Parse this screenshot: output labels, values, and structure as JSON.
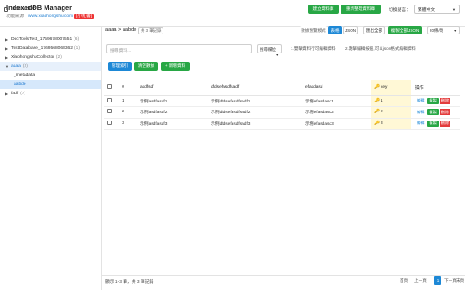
{
  "app": {
    "title": "IndexedDB Manager",
    "subtitle_prefix": "功能來源：",
    "subtitle_link": "www.xiaohongshu.com",
    "subtitle_badge": "[小紅書]"
  },
  "header": {
    "create_db": "建立資料庫",
    "reload_db": "重新整理資料庫",
    "lang_label": "切換語言：",
    "lang_value": "繁體中文"
  },
  "sidebar": {
    "title": "IndexedDB",
    "items": [
      {
        "label": "DocToolsTest_1759678007551",
        "count": "(6)"
      },
      {
        "label": "TestDatabase_1769568068362",
        "count": "(1)"
      },
      {
        "label": "XiaohongshuCollector",
        "count": "(2)"
      },
      {
        "label": "aaaa",
        "count": "(2)"
      },
      {
        "label": "_metadata"
      },
      {
        "label": "aabde"
      },
      {
        "label": "fadf",
        "count": "(7)"
      }
    ]
  },
  "main": {
    "breadcrumb": "aaaa > aabde",
    "records_badge": "共 3 筆記錄",
    "view_modes": {
      "label": "數據預覽模式",
      "table": "表格",
      "json": "JSON"
    },
    "export_all": "匯出全部",
    "copy_json": "複製全部JSON",
    "page_size": "20條/頁",
    "search_placeholder": "搜尋資料...",
    "field_select": "搜尋欄位",
    "hint1": "1.雙擊資料行可編輯資料",
    "hint2": "2.點擊編輯按鈕,可以json格式編輯資料",
    "manage_index": "管理索引",
    "clear_data": "清空數據",
    "add_data": "+ 新增資料",
    "columns": {
      "num": "#",
      "c1": "asdfsdf",
      "c2": "dfdsefasdfsadf",
      "c3": "efasdasd",
      "key": "key",
      "ops": "操作"
    },
    "rows": [
      {
        "num": "1",
        "c1": "示例asdfasdf1",
        "c2": "示例dfdsefasdfsadf1",
        "c3": "示例efasdasd1",
        "key": "1"
      },
      {
        "num": "2",
        "c1": "示例asdfasdf2",
        "c2": "示例dfdsefasdfsadf2",
        "c3": "示例efasdasd2",
        "key": "2"
      },
      {
        "num": "3",
        "c1": "示例asdfasdf3",
        "c2": "示例dfdsefasdfsadf3",
        "c3": "示例efasdasd3",
        "key": "3"
      }
    ],
    "row_actions": {
      "edit": "編輯",
      "copy": "複製",
      "delete": "刪除"
    },
    "footer": "顯示 1-3 筆，共 3 筆記錄",
    "pager": {
      "first": "首頁",
      "prev": "上一頁",
      "current": "1",
      "next": "下一頁",
      "last": "末頁"
    }
  },
  "colors": {
    "green": "#28a745",
    "blue": "#1d88d6",
    "red": "#e33c3c",
    "key_bg": "#fff8d6"
  }
}
